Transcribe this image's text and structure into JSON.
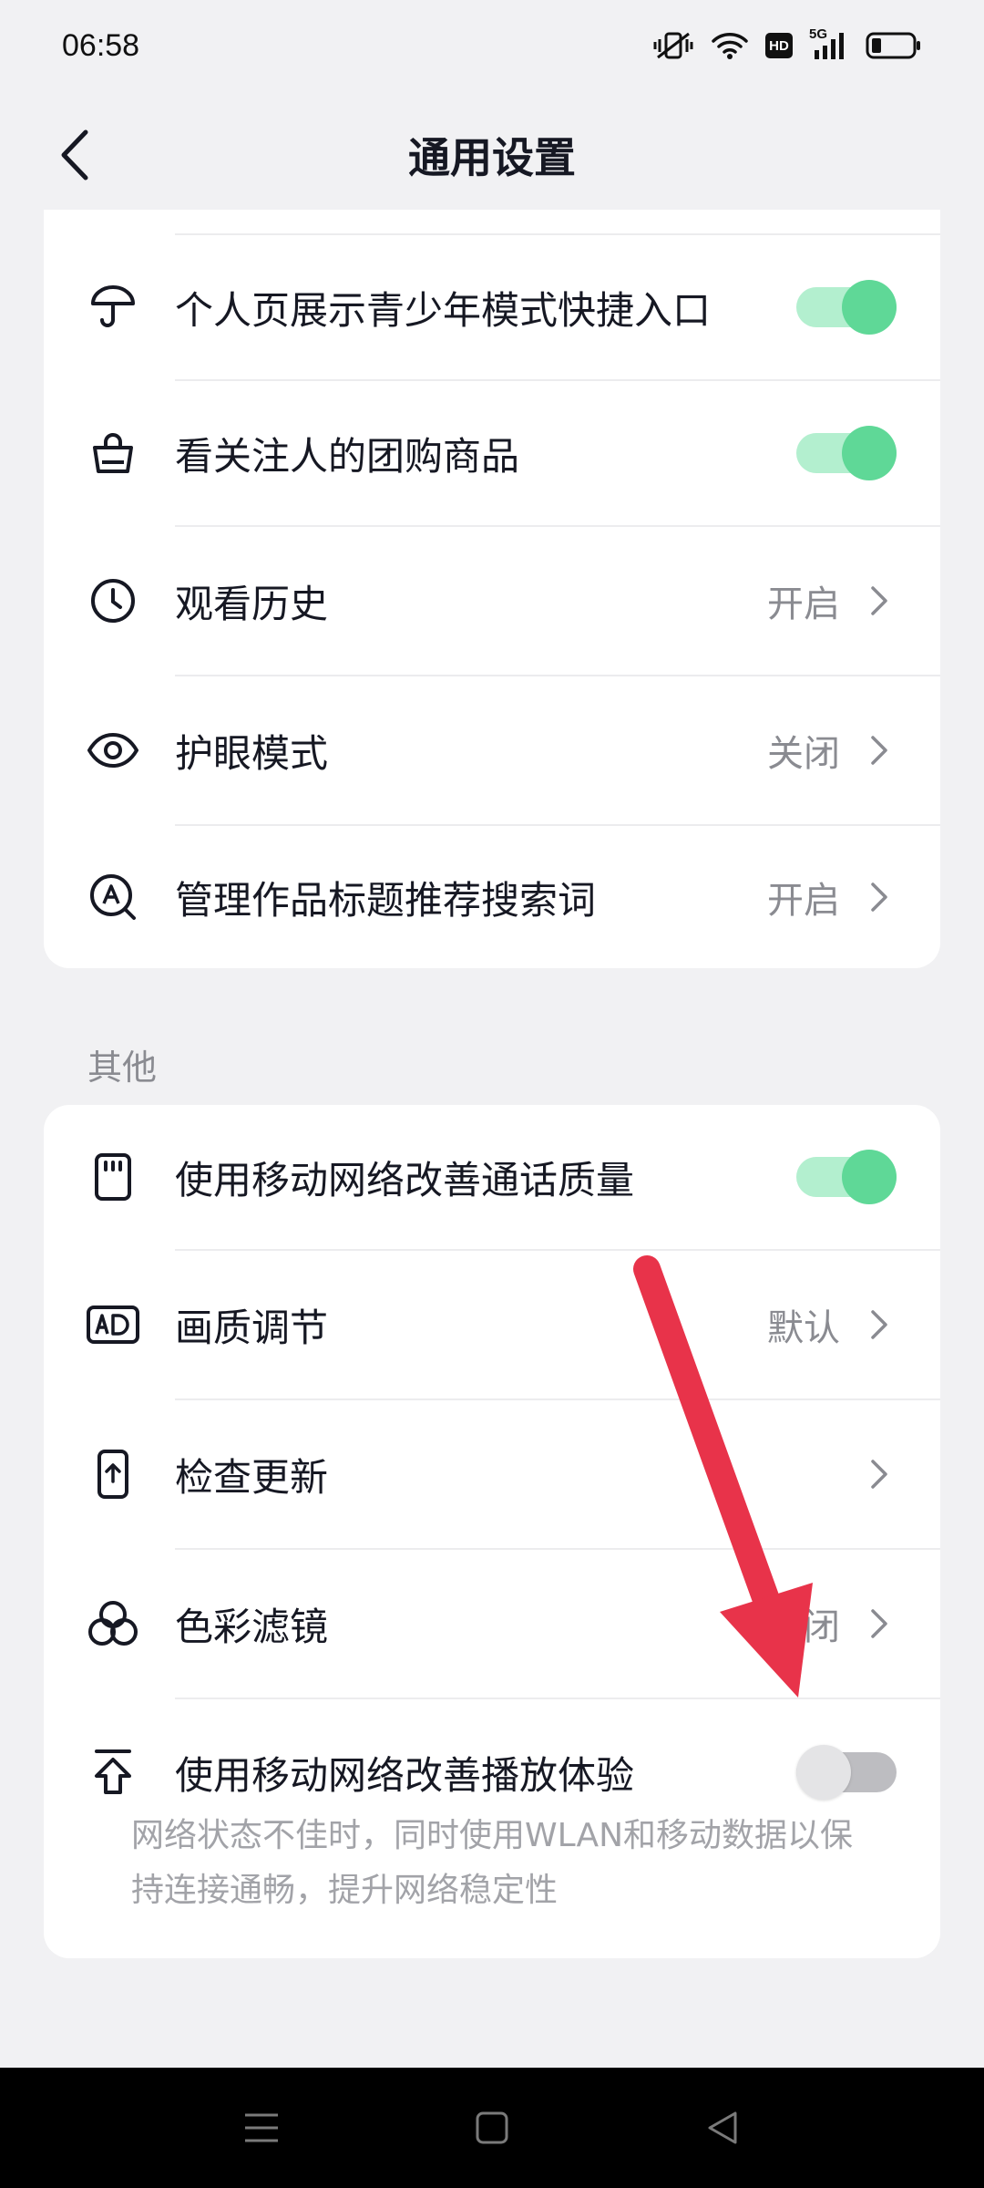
{
  "status_bar": {
    "time": "06:58",
    "network": "5G",
    "hd": "HD"
  },
  "header": {
    "title": "通用设置"
  },
  "top_card": {
    "items": [
      {
        "label": "个人页展示青少年模式快捷入口",
        "icon": "umbrella-icon",
        "toggle": true
      },
      {
        "label": "看关注人的团购商品",
        "icon": "shopping-bag-icon",
        "toggle": true
      },
      {
        "label": "观看历史",
        "icon": "clock-icon",
        "value": "开启"
      },
      {
        "label": "护眼模式",
        "icon": "eye-icon",
        "value": "关闭"
      },
      {
        "label": "管理作品标题推荐搜索词",
        "icon": "search-a-icon",
        "value": "开启"
      }
    ]
  },
  "other_section": {
    "title": "其他",
    "items": [
      {
        "label": "使用移动网络改善通话质量",
        "icon": "sim-card-icon",
        "toggle": true
      },
      {
        "label": "画质调节",
        "icon": "ad-icon",
        "value": "默认"
      },
      {
        "label": "检查更新",
        "icon": "phone-update-icon"
      },
      {
        "label": "色彩滤镜",
        "icon": "color-filter-icon",
        "value": "闭"
      },
      {
        "label": "使用移动网络改善播放体验",
        "icon": "upload-arrow-icon",
        "toggle": false,
        "description": "网络状态不佳时，同时使用WLAN和移动数据以保持连接通畅，提升网络稳定性"
      }
    ]
  },
  "colors": {
    "toggle_on": "#5fd897",
    "toggle_on_track": "#b3efcf",
    "annotation_arrow": "#e8334a"
  }
}
